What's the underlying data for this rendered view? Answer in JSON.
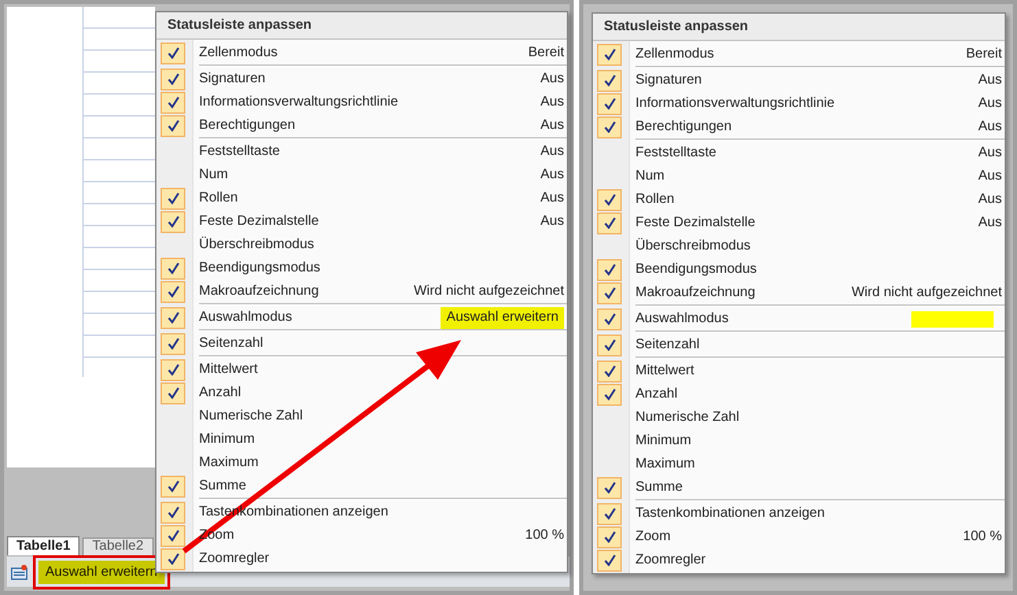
{
  "left_screenshot": {
    "sheet_tabs": [
      {
        "label": "Tabelle1",
        "selected": true
      },
      {
        "label": "Tabelle2",
        "selected": false
      }
    ],
    "status_bar": {
      "indicator": "Auswahl erweitern"
    },
    "menu": {
      "title": "Statusleiste anpassen",
      "groups": [
        {
          "items": [
            {
              "label": "Zellenmodus",
              "value": "Bereit",
              "checked": true
            }
          ]
        },
        {
          "items": [
            {
              "label": "Signaturen",
              "value": "Aus",
              "checked": true
            },
            {
              "label": "Informationsverwaltungsrichtlinie",
              "value": "Aus",
              "checked": true
            },
            {
              "label": "Berechtigungen",
              "value": "Aus",
              "checked": true
            }
          ]
        },
        {
          "items": [
            {
              "label": "Feststelltaste",
              "value": "Aus",
              "checked": false
            },
            {
              "label": "Num",
              "value": "Aus",
              "checked": false
            },
            {
              "label": "Rollen",
              "value": "Aus",
              "checked": true
            },
            {
              "label": "Feste Dezimalstelle",
              "value": "Aus",
              "checked": true
            },
            {
              "label": "Überschreibmodus",
              "checked": false
            },
            {
              "label": "Beendigungsmodus",
              "checked": true
            },
            {
              "label": "Makroaufzeichnung",
              "value": "Wird nicht aufgezeichnet",
              "checked": true
            }
          ]
        },
        {
          "items": [
            {
              "label": "Auswahlmodus",
              "value": "Auswahl erweitern",
              "checked": true,
              "highlighted": true
            }
          ]
        },
        {
          "items": [
            {
              "label": "Seitenzahl",
              "checked": true
            }
          ]
        },
        {
          "items": [
            {
              "label": "Mittelwert",
              "checked": true
            },
            {
              "label": "Anzahl",
              "checked": true
            },
            {
              "label": "Numerische Zahl",
              "checked": false
            },
            {
              "label": "Minimum",
              "checked": false
            },
            {
              "label": "Maximum",
              "checked": false
            },
            {
              "label": "Summe",
              "checked": true
            }
          ]
        },
        {
          "items": [
            {
              "label": "Tastenkombinationen anzeigen",
              "checked": true
            },
            {
              "label": "Zoom",
              "value": "100 %",
              "checked": true
            },
            {
              "label": "Zoomregler",
              "checked": true
            }
          ]
        }
      ]
    }
  },
  "right_screenshot": {
    "menu": {
      "title": "Statusleiste anpassen",
      "groups": [
        {
          "items": [
            {
              "label": "Zellenmodus",
              "value": "Bereit",
              "checked": true
            }
          ]
        },
        {
          "items": [
            {
              "label": "Signaturen",
              "value": "Aus",
              "checked": true
            },
            {
              "label": "Informationsverwaltungsrichtlinie",
              "value": "Aus",
              "checked": true
            },
            {
              "label": "Berechtigungen",
              "value": "Aus",
              "checked": true
            }
          ]
        },
        {
          "items": [
            {
              "label": "Feststelltaste",
              "value": "Aus",
              "checked": false
            },
            {
              "label": "Num",
              "value": "Aus",
              "checked": false
            },
            {
              "label": "Rollen",
              "value": "Aus",
              "checked": true
            },
            {
              "label": "Feste Dezimalstelle",
              "value": "Aus",
              "checked": true
            },
            {
              "label": "Überschreibmodus",
              "checked": false
            },
            {
              "label": "Beendigungsmodus",
              "checked": true
            },
            {
              "label": "Makroaufzeichnung",
              "value": "Wird nicht aufgezeichnet",
              "checked": true
            }
          ]
        },
        {
          "items": [
            {
              "label": "Auswahlmodus",
              "checked": true,
              "highlighted": true
            }
          ]
        },
        {
          "items": [
            {
              "label": "Seitenzahl",
              "checked": true
            }
          ]
        },
        {
          "items": [
            {
              "label": "Mittelwert",
              "checked": true
            },
            {
              "label": "Anzahl",
              "checked": true
            },
            {
              "label": "Numerische Zahl",
              "checked": false
            },
            {
              "label": "Minimum",
              "checked": false
            },
            {
              "label": "Maximum",
              "checked": false
            },
            {
              "label": "Summe",
              "checked": true
            }
          ]
        },
        {
          "items": [
            {
              "label": "Tastenkombinationen anzeigen",
              "checked": true
            },
            {
              "label": "Zoom",
              "value": "100 %",
              "checked": true
            },
            {
              "label": "Zoomregler",
              "checked": true
            }
          ]
        }
      ]
    }
  }
}
